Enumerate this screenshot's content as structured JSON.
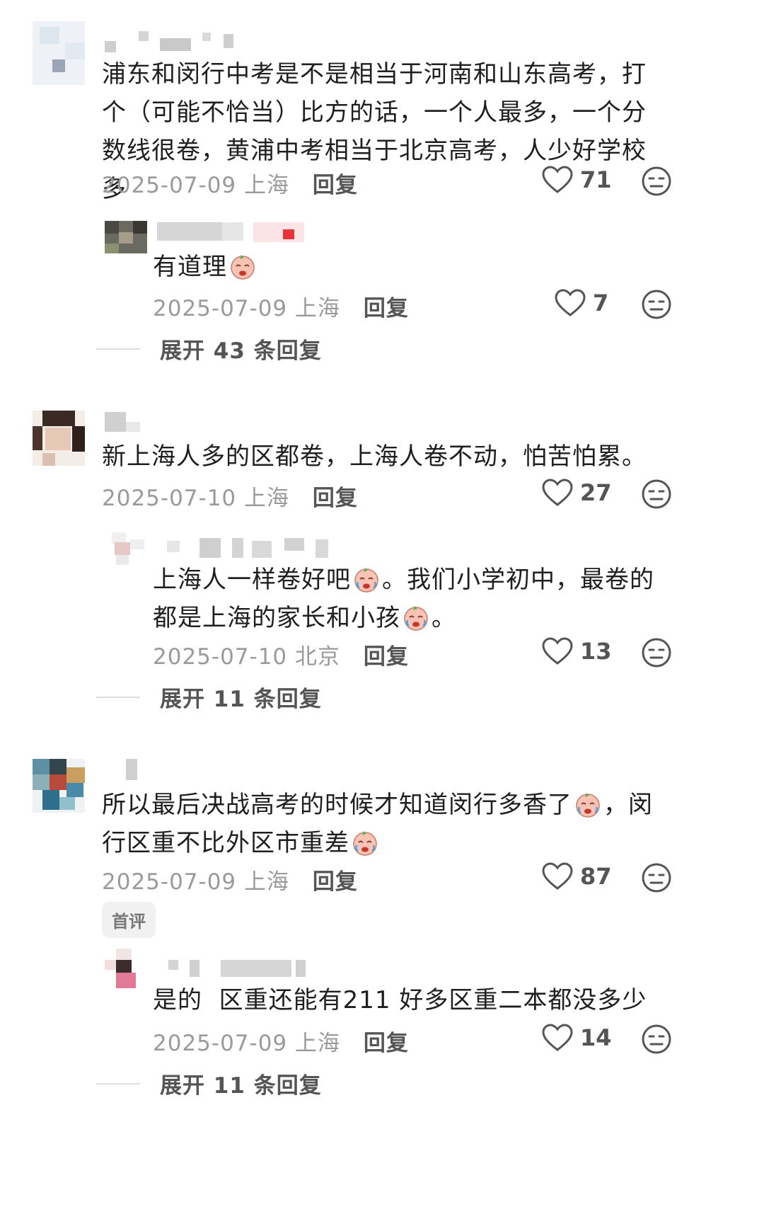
{
  "comments": [
    {
      "text": "浦东和闵行中考是不是相当于河南和山东高考，打个（可能不恰当）比方的话，一个人最多，一个分数线很卷，黄浦中考相当于北京高考，人少好学校多",
      "date": "2025-07-09",
      "location": "上海",
      "reply_label": "回复",
      "likes": "71",
      "replies": [
        {
          "text": "有道理",
          "date": "2025-07-09",
          "location": "上海",
          "reply_label": "回复",
          "likes": "7"
        }
      ],
      "expand_label": "展开 43 条回复"
    },
    {
      "text": "新上海人多的区都卷，上海人卷不动，怕苦怕累。",
      "date": "2025-07-10",
      "location": "上海",
      "reply_label": "回复",
      "likes": "27",
      "replies": [
        {
          "text_parts": [
            "上海人一样卷好吧",
            "。我们小学初中，最卷的都是上海的家长和小孩",
            "。"
          ],
          "date": "2025-07-10",
          "location": "北京",
          "reply_label": "回复",
          "likes": "13"
        }
      ],
      "expand_label": "展开 11 条回复"
    },
    {
      "text_parts": [
        "所以最后决战高考的时候才知道闵行多香了",
        "，闵行区重不比外区市重差"
      ],
      "date": "2025-07-09",
      "location": "上海",
      "reply_label": "回复",
      "likes": "87",
      "tag": "首评",
      "replies": [
        {
          "text": "是的  区重还能有211 好多区重二本都没多少",
          "date": "2025-07-09",
          "location": "上海",
          "reply_label": "回复",
          "likes": "14"
        }
      ],
      "expand_label": "展开 11 条回复"
    }
  ],
  "icons": {
    "like": "heart-outline-icon",
    "dislike": "meh-face-icon",
    "emoji": "crying-face-emoji"
  }
}
